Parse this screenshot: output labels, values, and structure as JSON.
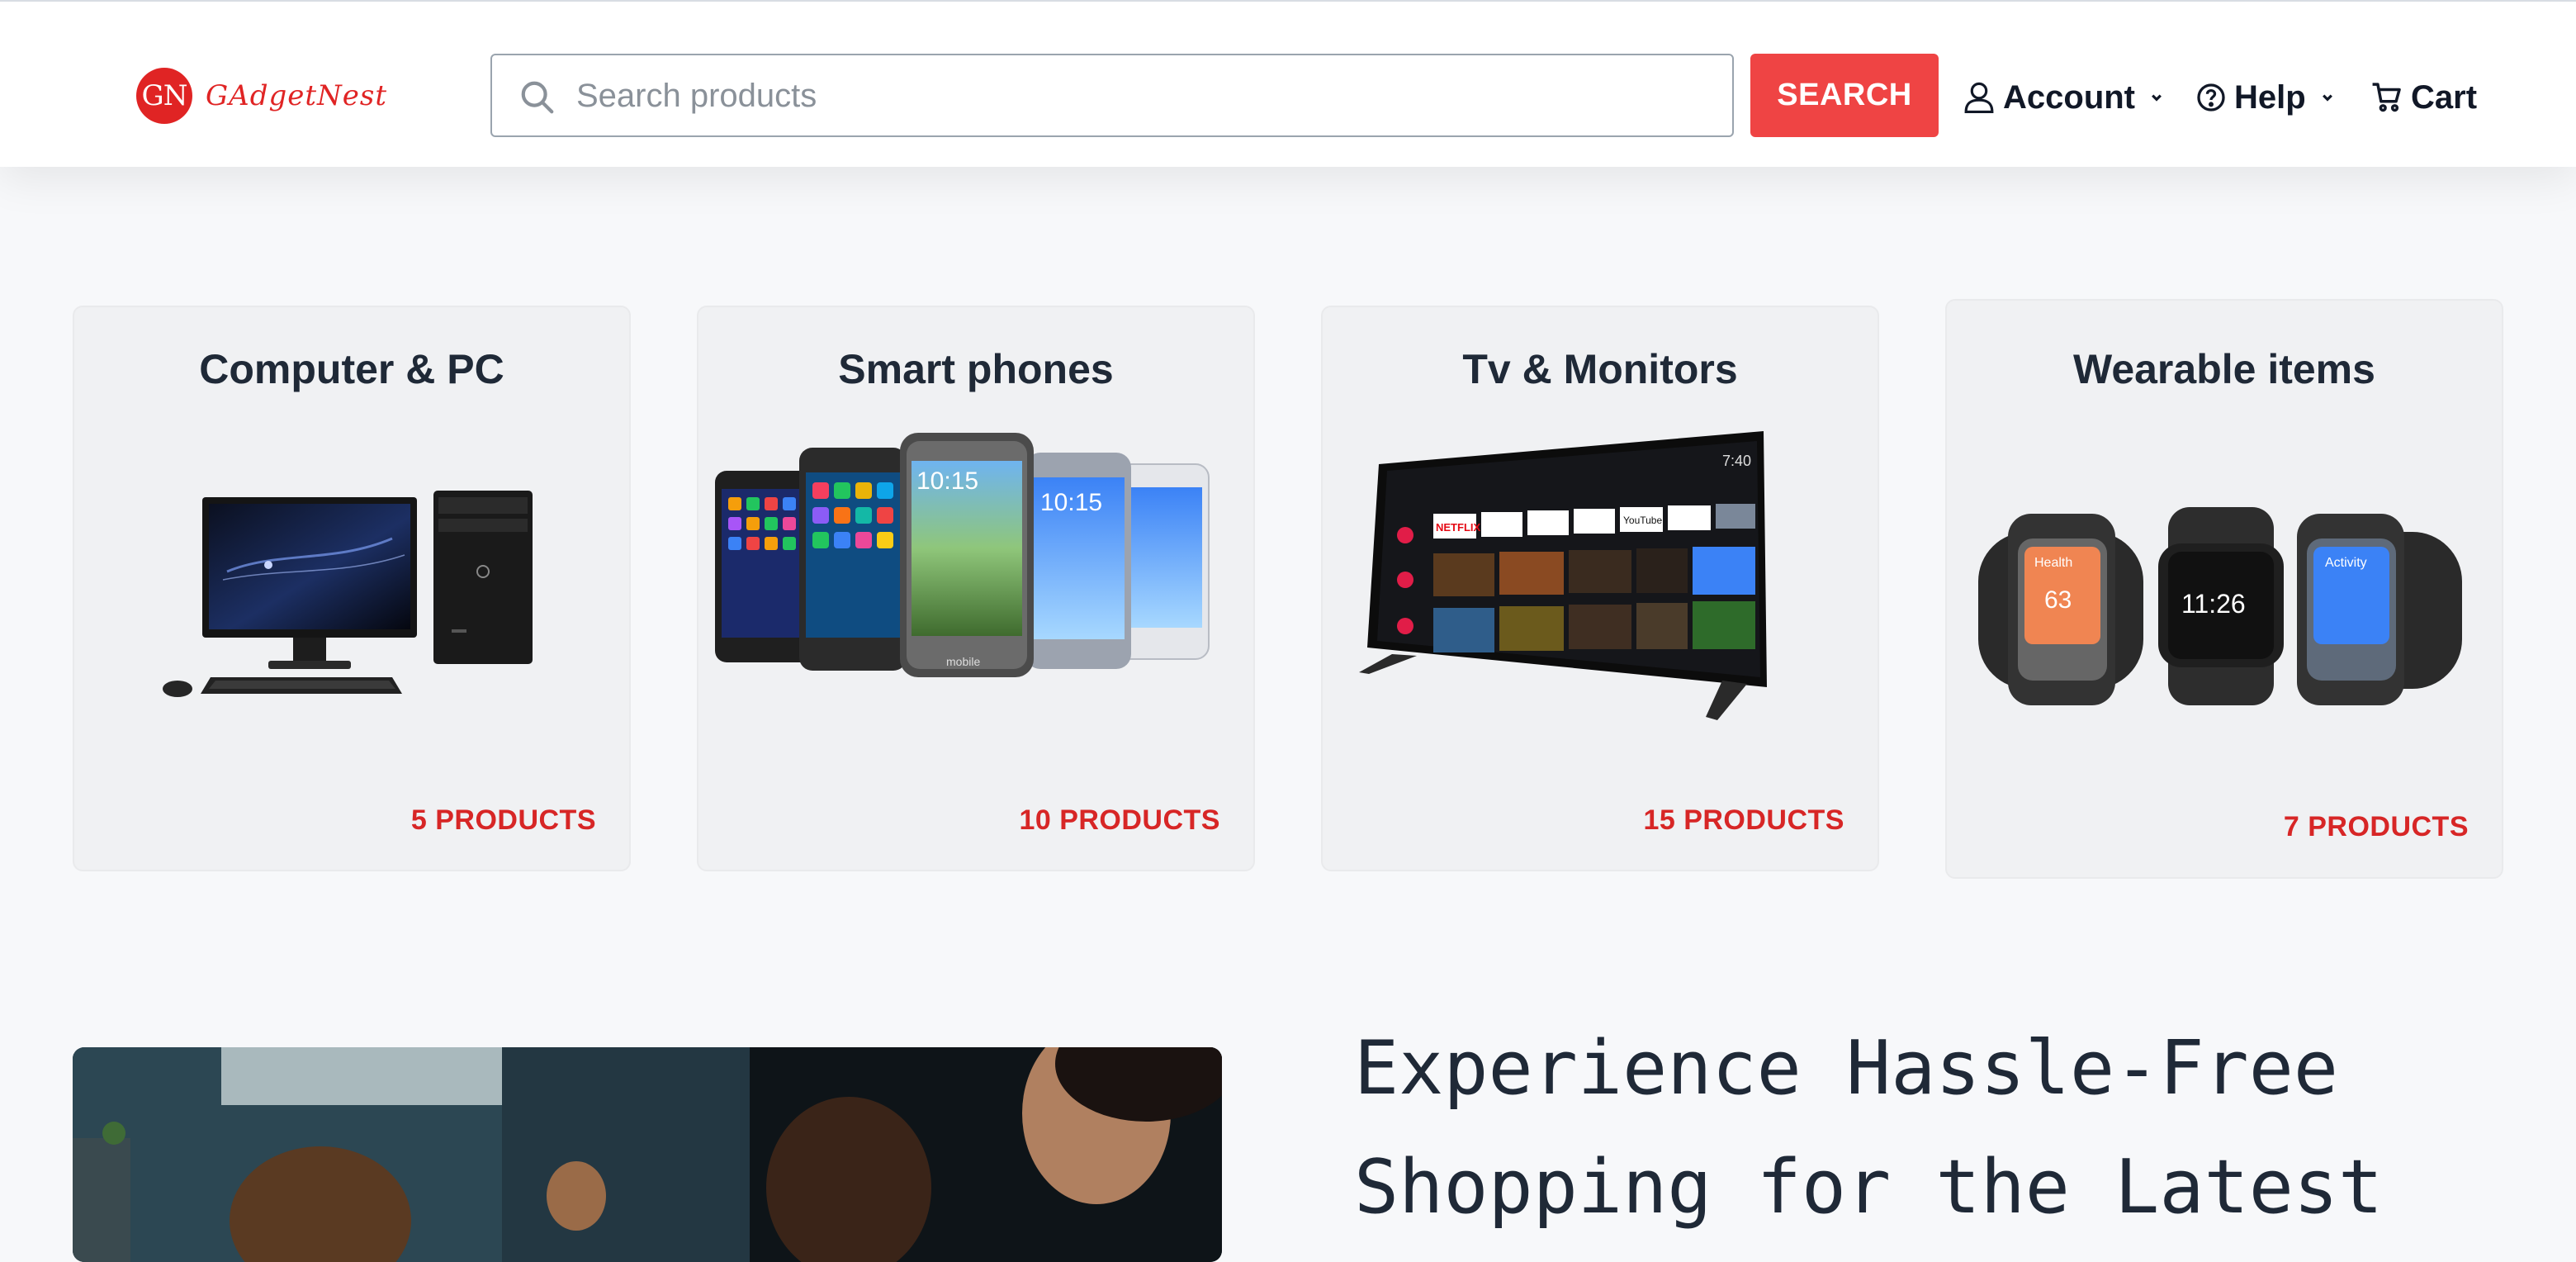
{
  "brand": {
    "badge": "GN",
    "name": "GAdgetNest",
    "color": "#e02424"
  },
  "search": {
    "placeholder": "Search products",
    "value": "",
    "button_label": "SEARCH",
    "button_color": "#ef4444"
  },
  "nav": {
    "account": {
      "label": "Account",
      "icon": "user-icon",
      "dropdown": true
    },
    "help": {
      "label": "Help",
      "icon": "question-circle-icon",
      "dropdown": true
    },
    "cart": {
      "label": "Cart",
      "icon": "cart-icon"
    }
  },
  "categories": [
    {
      "title": "Computer & PC",
      "count": "5 PRODUCTS",
      "image": "desktop-computer-image"
    },
    {
      "title": "Smart phones",
      "count": "10 PRODUCTS",
      "image": "smartphones-image"
    },
    {
      "title": "Tv & Monitors",
      "count": "15 PRODUCTS",
      "image": "smart-tv-image"
    },
    {
      "title": "Wearable items",
      "count": "7 PRODUCTS",
      "image": "smartwatches-image"
    }
  ],
  "phone_screens": {
    "time": "10:15",
    "brand": "mobile"
  },
  "watch_screens": {
    "health": "Health",
    "heart_value": "63",
    "time": "11:26",
    "activity": "Activity"
  },
  "tv_screen": {
    "clock": "7:40",
    "netflix": "NETFLIX",
    "youtube": "YouTube"
  },
  "accent_color": "#d72626",
  "hero": {
    "title": "Experience Hassle-Free Shopping for the Latest"
  }
}
